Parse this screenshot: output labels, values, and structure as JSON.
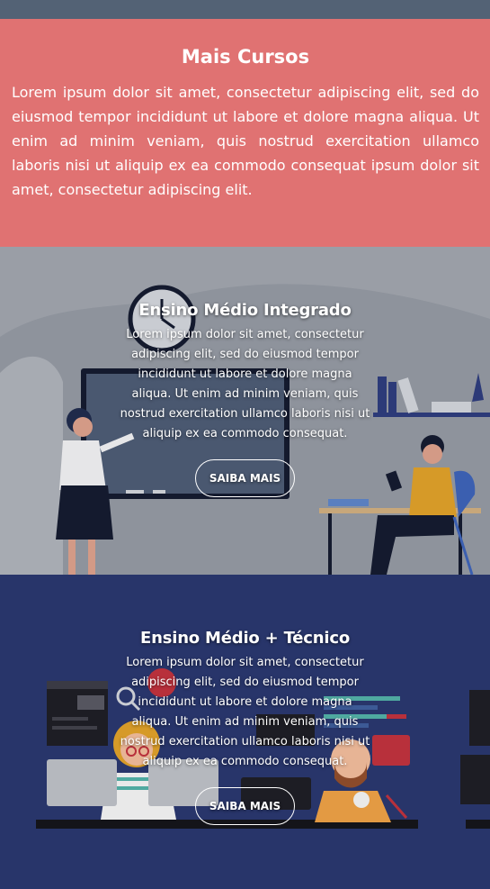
{
  "intro": {
    "title": "Mais Cursos",
    "text": "Lorem ipsum dolor sit amet, consectetur adipiscing elit, sed do eiusmod tempor incididunt ut labore et dolore magna aliqua. Ut enim ad minim veniam, quis nostrud exercitation ullamco laboris nisi ut aliquip ex ea commodo consequat ipsum dolor sit amet, consectetur adipiscing elit."
  },
  "courses": [
    {
      "title": "Ensino Médio Integrado",
      "text": "Lorem ipsum dolor sit amet, consectetur adipiscing elit, sed do eiusmod tempor incididunt ut labore et dolore magna aliqua. Ut enim ad minim veniam, quis nostrud exercitation ullamco laboris nisi ut aliquip ex ea commodo consequat.",
      "button": "SAIBA MAIS"
    },
    {
      "title": "Ensino Médio + Técnico",
      "text": "Lorem ipsum dolor sit amet, consectetur adipiscing elit, sed do eiusmod tempor incididunt ut labore et dolore magna aliqua. Ut enim ad minim veniam, quis nostrud exercitation ullamco laboris nisi ut aliquip ex ea commodo consequat.",
      "button": "SAIBA MAIS"
    }
  ],
  "colors": {
    "topbar": "#536275",
    "intro_bg": "#e07272",
    "panel1_bg": "#9a9ea6",
    "panel2_bg": "#28356a"
  }
}
